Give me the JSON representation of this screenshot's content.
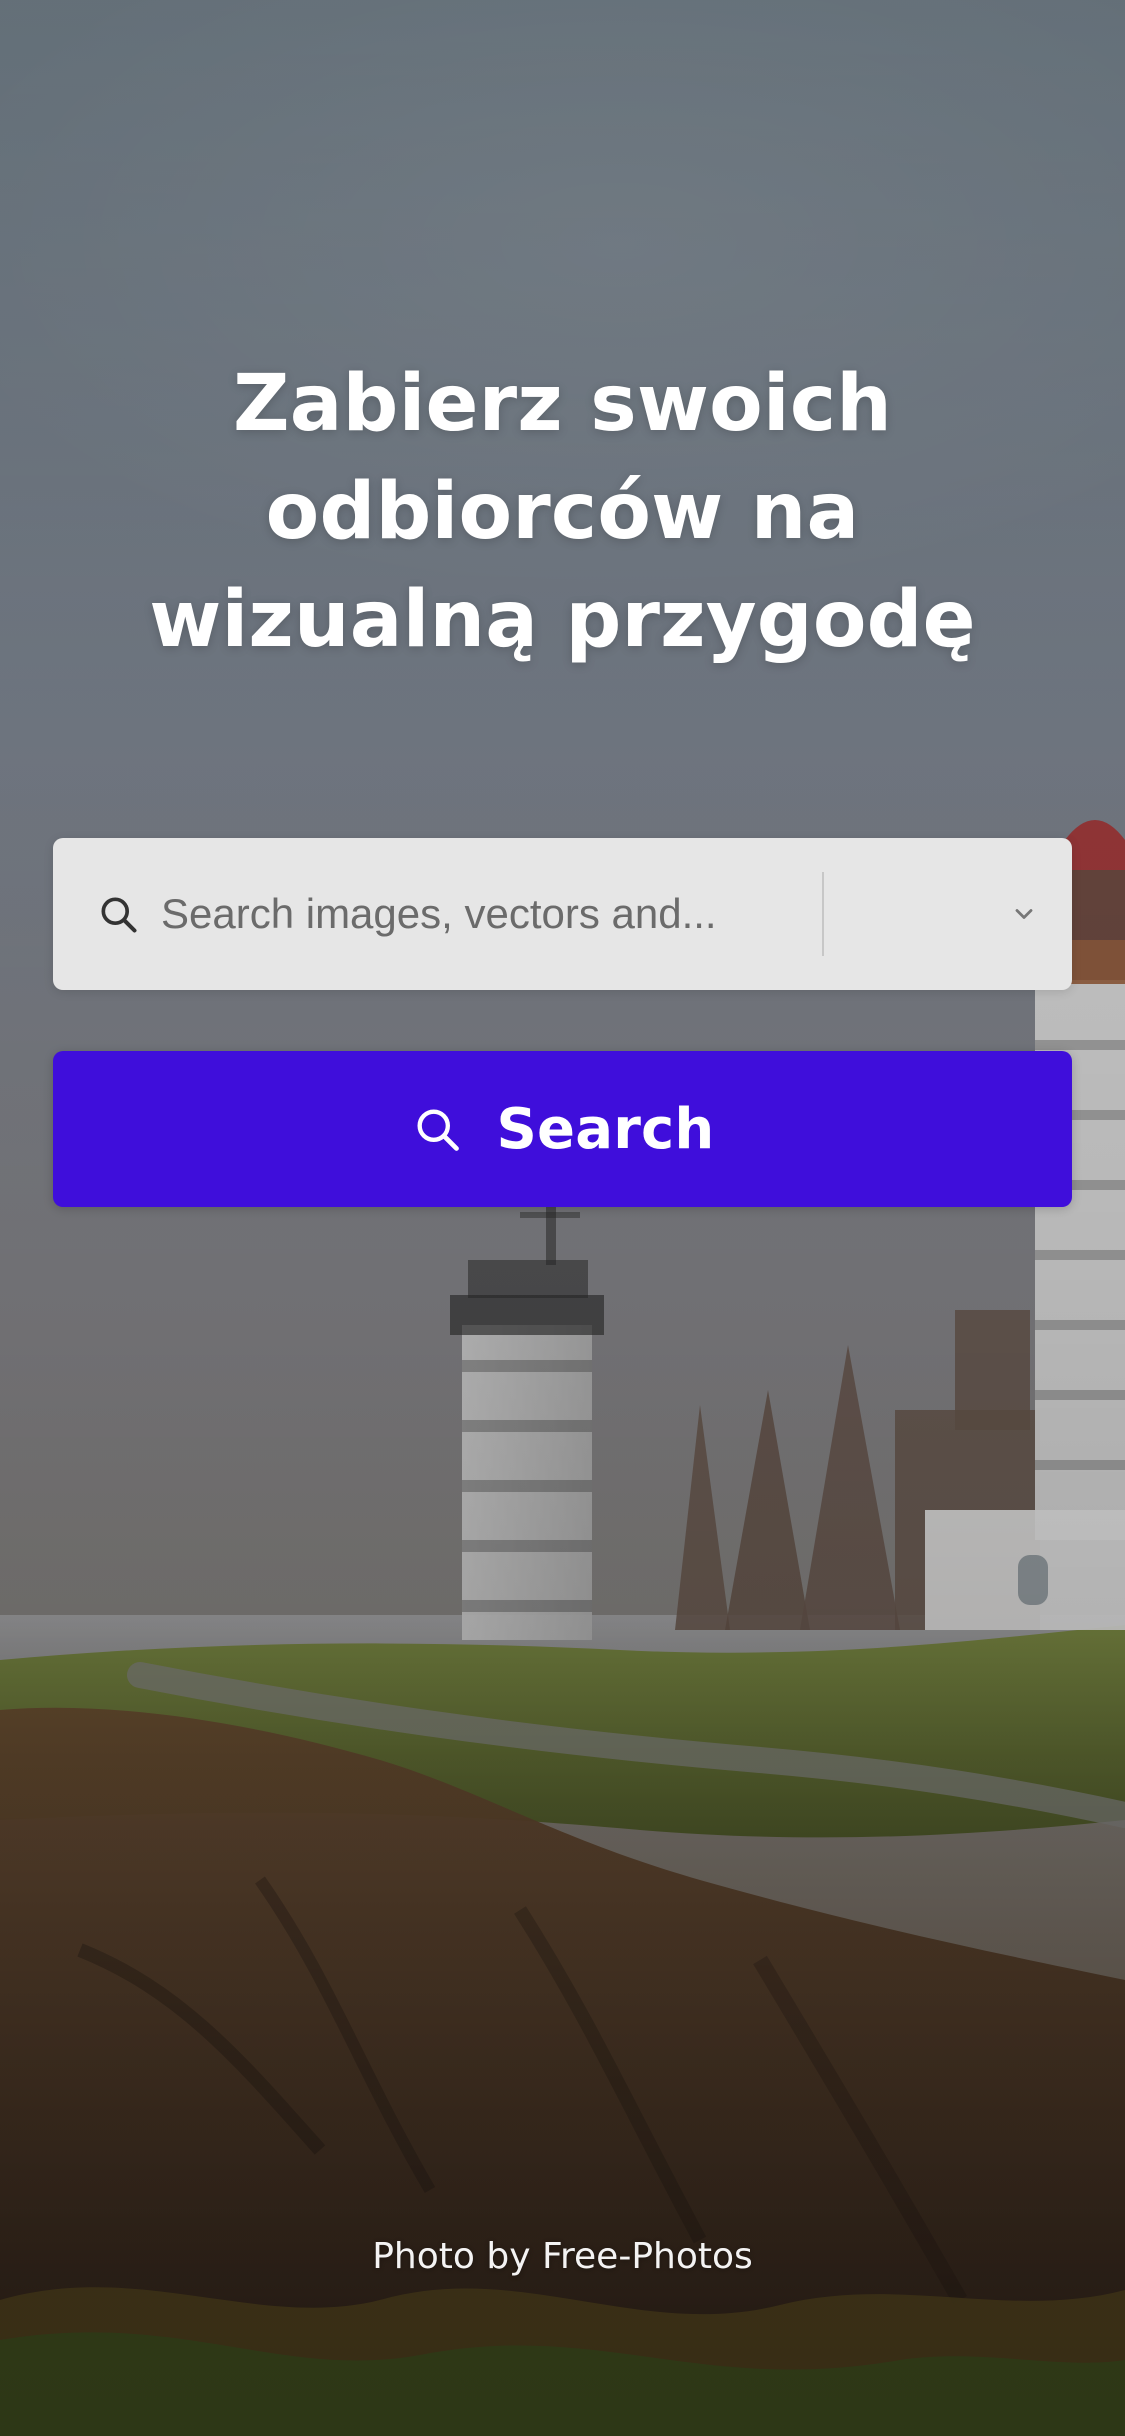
{
  "hero": {
    "title": "Zabierz swoich odbiorców na wizualną przygodę"
  },
  "search": {
    "placeholder": "Search images, vectors and...",
    "value": "",
    "filter_value": ""
  },
  "actions": {
    "search_button_label": "Search"
  },
  "credits": {
    "photo_credit": "Photo by Free-Photos"
  },
  "theme": {
    "primary": "#3F0EDB",
    "search_bar_bg": "#E6E6E6"
  },
  "icons": {
    "search": "search-icon",
    "chevron_down": "chevron-down-icon"
  }
}
